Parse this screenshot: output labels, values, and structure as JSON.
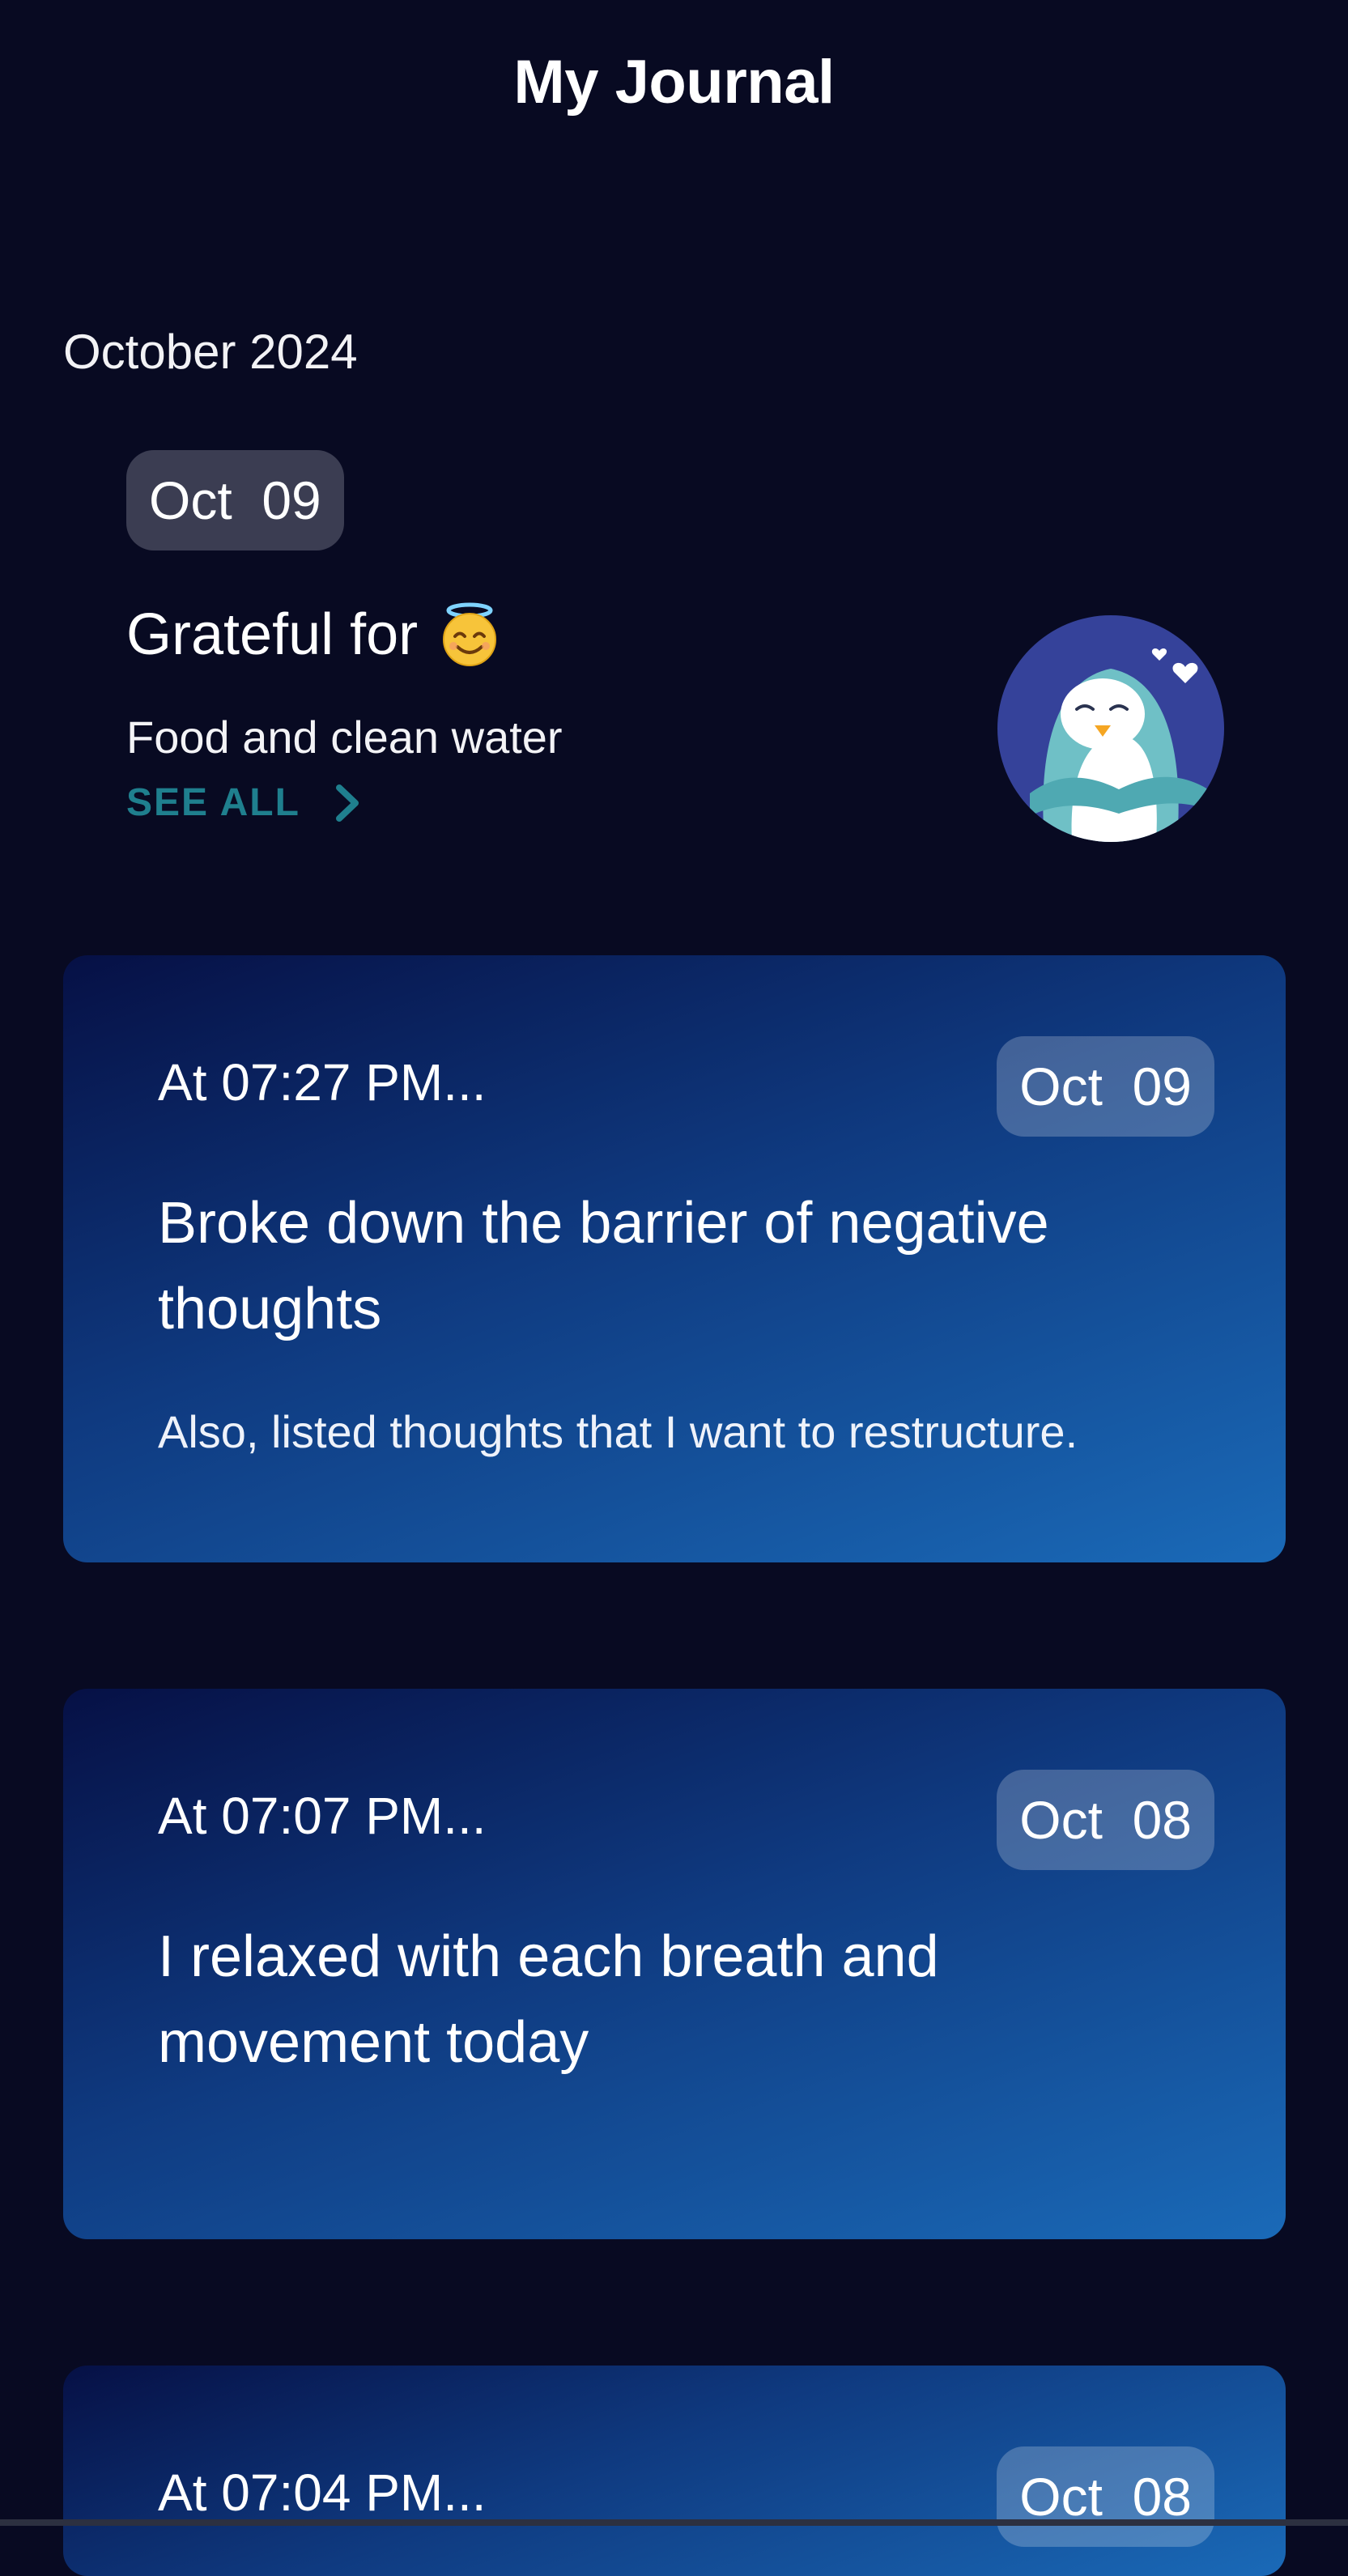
{
  "header": {
    "title": "My Journal"
  },
  "month": "October 2024",
  "gratitude": {
    "date": "Oct  09",
    "title": "Grateful for",
    "emoji": "smiling-face-with-halo",
    "text": "Food and clean water",
    "see_all": "SEE ALL",
    "mascot": "penguin-hearts-illustration"
  },
  "entries": [
    {
      "time": "At 07:27 PM...",
      "date": "Oct  09",
      "title": "Broke down the barrier of negative thoughts",
      "body": "Also, listed thoughts that I want to restructure."
    },
    {
      "time": "At 07:07 PM...",
      "date": "Oct  08",
      "title": "I relaxed with each breath and movement today",
      "body": ""
    },
    {
      "time": "At 07:04 PM...",
      "date": "Oct  08",
      "title": "",
      "body": ""
    }
  ],
  "colors": {
    "background": "#080a22",
    "accent_teal": "#1f7f8e",
    "chip_dark": "#3b3d52",
    "card_gradient_start": "#061045",
    "card_gradient_end": "#1a6ab8"
  }
}
